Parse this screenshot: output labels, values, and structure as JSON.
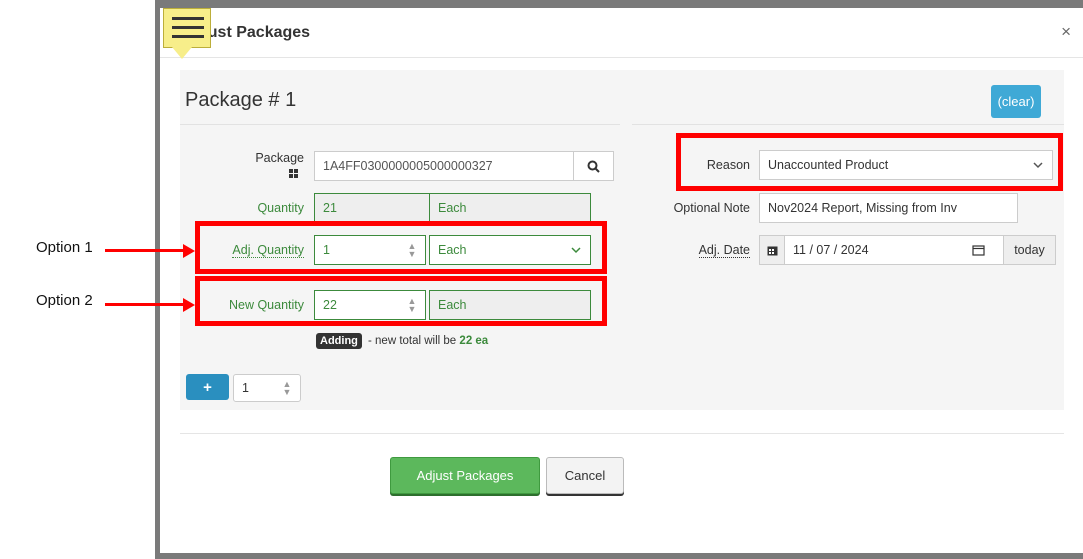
{
  "modal": {
    "title": "Adjust Packages",
    "close_glyph": "×",
    "menu_icon": "hamburger-menu-icon"
  },
  "package": {
    "heading": "Package # 1",
    "clear_label": "(clear)",
    "package_label": "Package",
    "package_icon": "grid-icon",
    "package_value": "1A4FF0300000005000000327",
    "search_icon": "search-icon",
    "quantity_label": "Quantity",
    "quantity_value": "21",
    "quantity_unit": "Each",
    "adj_quantity_label": "Adj. Quantity",
    "adj_quantity_value": "1",
    "adj_unit_value": "Each",
    "new_quantity_label": "New Quantity",
    "new_quantity_value": "22",
    "new_quantity_unit": "Each",
    "badge": "Adding",
    "hint_prefix": "- new total will be",
    "hint_total": "22 ea"
  },
  "right": {
    "reason_label": "Reason",
    "reason_value": "Unaccounted Product",
    "note_label": "Optional Note",
    "note_value": "Nov2024 Report, Missing from Inv",
    "date_label": "Adj. Date",
    "date_value": "11 / 07 / 2024",
    "today_label": "today"
  },
  "add_row": {
    "plus": "+",
    "count_value": "1"
  },
  "buttons": {
    "submit": "Adjust Packages",
    "cancel": "Cancel"
  },
  "annotations": {
    "option1": "Option 1",
    "option2": "Option 2"
  },
  "colors": {
    "highlight": "#ff0000",
    "green_label": "#3c8a3c",
    "info_button": "#3fa9d6",
    "primary_button": "#5cb85c"
  }
}
